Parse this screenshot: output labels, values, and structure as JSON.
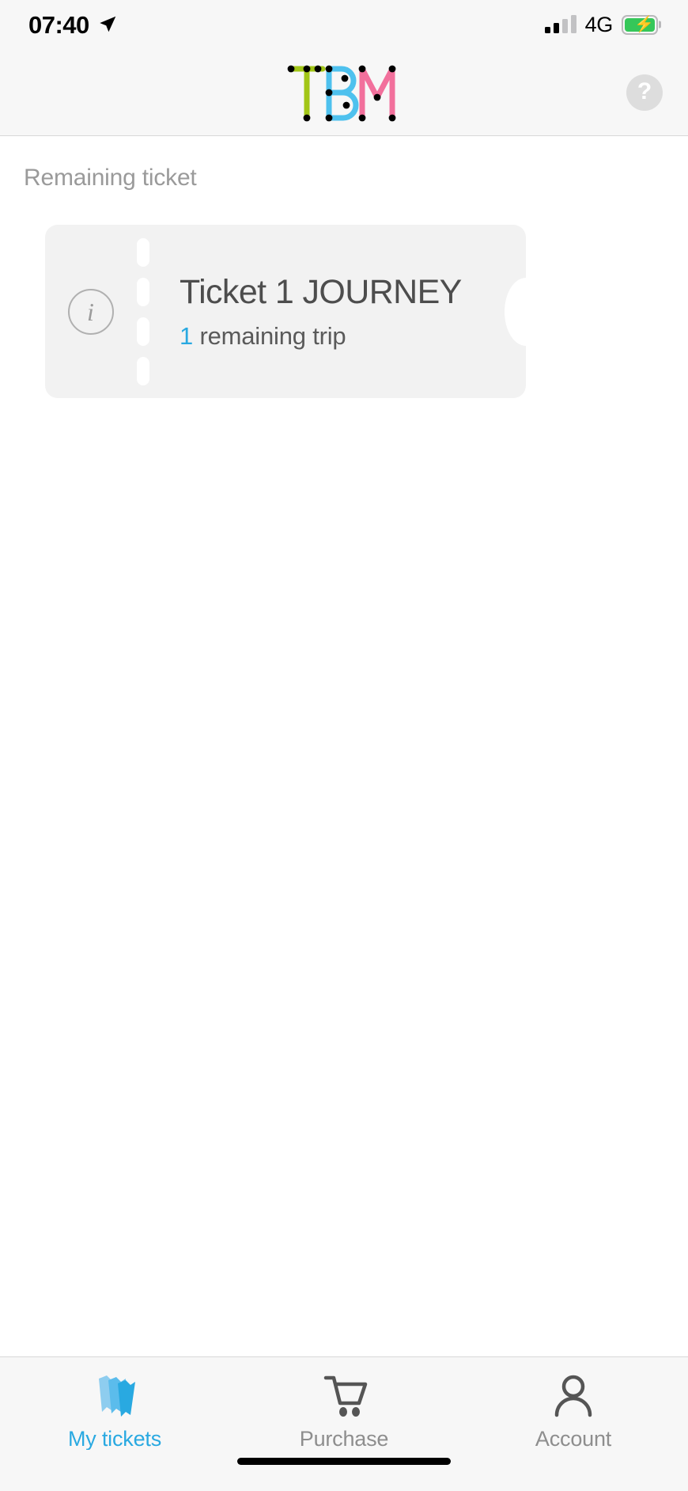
{
  "status_bar": {
    "time": "07:40",
    "location_icon": "location-arrow-icon",
    "signal_icon": "signal-bars-icon",
    "network": "4G",
    "battery_icon": "battery-charging-icon",
    "battery_color": "#35c759"
  },
  "header": {
    "logo": {
      "name": "tbm-logo",
      "letters": [
        "T",
        "B",
        "M"
      ],
      "colors": {
        "t": "#a2c617",
        "b": "#4ec1ee",
        "m": "#f2709c",
        "dots": "#000000"
      }
    },
    "help_button": {
      "icon": "question-mark-icon",
      "label": "?"
    }
  },
  "main": {
    "section_label": "Remaining ticket",
    "tickets": [
      {
        "info_icon": "info-circle-icon",
        "title": "Ticket 1 JOURNEY",
        "remaining_count": "1",
        "remaining_text": " remaining trip",
        "accent_color": "#29a9e1",
        "card_color": "#f2f2f2"
      }
    ]
  },
  "tab_bar": {
    "active_index": 0,
    "active_color": "#29a9e1",
    "inactive_color": "#8e8e8e",
    "tabs": [
      {
        "label": "My tickets",
        "icon": "tickets-icon"
      },
      {
        "label": "Purchase",
        "icon": "shopping-cart-icon"
      },
      {
        "label": "Account",
        "icon": "person-icon"
      }
    ],
    "home_indicator": "home-indicator-bar"
  }
}
